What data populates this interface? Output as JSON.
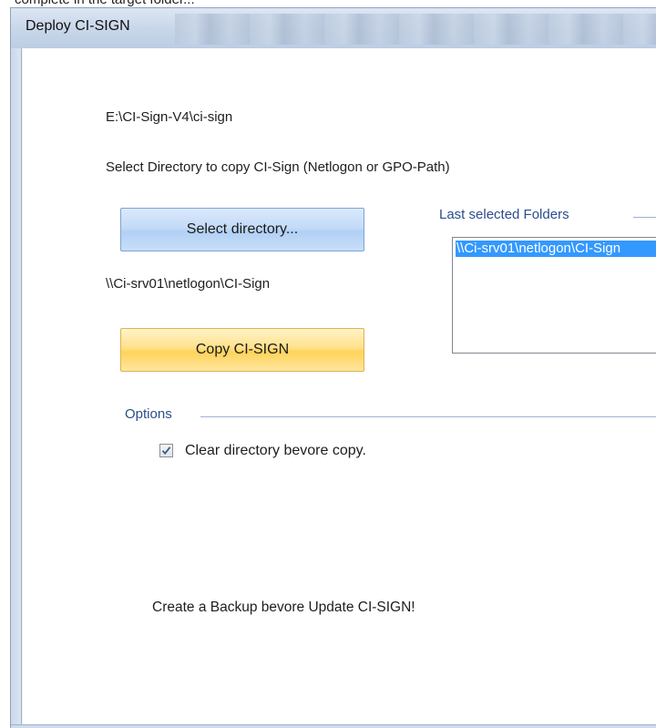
{
  "page_top_text": "complete in the target folder...",
  "window": {
    "title": "Deploy CI-SIGN"
  },
  "source_path": "E:\\CI-Sign-V4\\ci-sign",
  "select_prompt": "Select Directory to copy CI-Sign (Netlogon or GPO-Path)",
  "buttons": {
    "select_directory": "Select directory...",
    "copy": "Copy CI-SIGN"
  },
  "selected_path": "\\\\Ci-srv01\\netlogon\\CI-Sign",
  "last_folders": {
    "legend": "Last selected Folders",
    "items": [
      "\\\\Ci-srv01\\netlogon\\CI-Sign"
    ]
  },
  "options": {
    "legend": "Options",
    "clear_directory": {
      "label": "Clear directory bevore copy.",
      "checked": true
    }
  },
  "backup_notice": "Create a Backup bevore Update CI-SIGN!",
  "colors": {
    "selection": "#3399ff",
    "group_legend": "#2b4d8c",
    "select_button": "#c3dbf7",
    "copy_button": "#ffd35a"
  }
}
